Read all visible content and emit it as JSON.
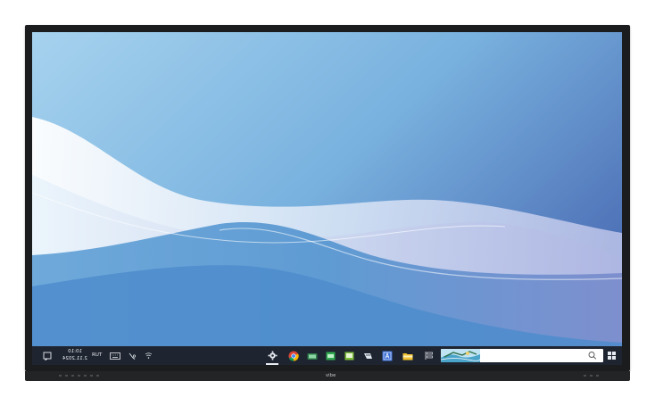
{
  "device": {
    "brand": "vibe"
  },
  "taskbar": {
    "clock": {
      "time": "10:10",
      "date": "2.11.2024"
    },
    "language": "RUT",
    "search": {
      "placeholder": "",
      "value": ""
    }
  },
  "colors": {
    "taskbar_bg": "#1f2530",
    "wallpaper_top": "#8ec2e6",
    "wallpaper_right": "#5a7fc0",
    "bezel": "#1b1c1e"
  },
  "icons": {
    "left": [
      "notification-icon",
      "keyboard-icon",
      "pen-icon",
      "wifi-icon"
    ],
    "apps": [
      "settings-icon",
      "chrome-icon",
      "camera-icon",
      "spreadsheet-icon",
      "whiteboard-icon",
      "arrow-app-icon",
      "text-app-icon",
      "folder-icon",
      "tools-icon"
    ],
    "right": [
      "search-icon",
      "start-icon"
    ]
  }
}
